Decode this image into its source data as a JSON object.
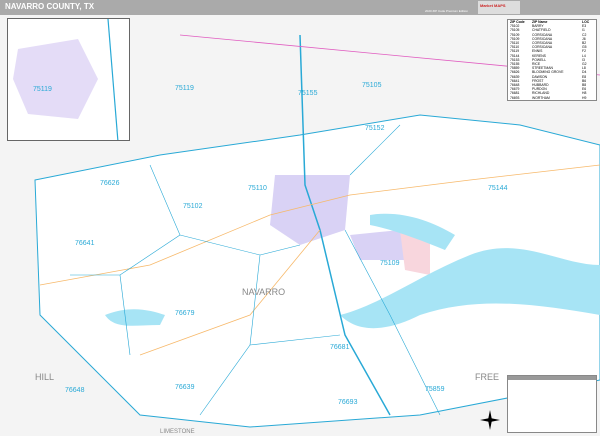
{
  "header": {
    "title": "NAVARRO COUNTY, TX",
    "edition": "2020 ZIP Code Premium Edition",
    "logo": "Market MAPS"
  },
  "zip_table": {
    "headers": [
      "ZIP Code",
      "ZIP Name",
      "LOC"
    ],
    "rows": [
      [
        "75102",
        "BARRY",
        "E3"
      ],
      [
        "75105",
        "CHATFIELD",
        "I1"
      ],
      [
        "75109",
        "CORSICANA",
        "C2"
      ],
      [
        "75109",
        "CORSICANA",
        "J6"
      ],
      [
        "75110",
        "CORSICANA",
        "B2"
      ],
      [
        "75110",
        "CORSICANA",
        "G5"
      ],
      [
        "75119",
        "ENNIS",
        "F2"
      ],
      [
        "75144",
        "KERENS",
        "L4"
      ],
      [
        "75153",
        "POWELL",
        "I3"
      ],
      [
        "75155",
        "RICE",
        "G2"
      ],
      [
        "75859",
        "STREETMAN",
        "L8"
      ],
      [
        "76626",
        "BLOOMING GROVE",
        "D4"
      ],
      [
        "76639",
        "DAWSON",
        "E8"
      ],
      [
        "76641",
        "FROST",
        "B6"
      ],
      [
        "76648",
        "HUBBARD",
        "B8"
      ],
      [
        "76679",
        "PURDON",
        "E6"
      ],
      [
        "76681",
        "RICHLAND",
        "H8"
      ],
      [
        "76693",
        "WORTHAM",
        "H9"
      ]
    ]
  },
  "map_labels": {
    "county": "NAVARRO",
    "neighbors": [
      "HILL",
      "FREE",
      "LIMESTONE"
    ],
    "zips": [
      "75119",
      "75155",
      "75105",
      "75152",
      "75110",
      "76626",
      "75102",
      "76641",
      "75144",
      "75109",
      "76679",
      "76681",
      "75859",
      "76648",
      "76639",
      "76693"
    ],
    "inset_zip": "75119"
  },
  "colors": {
    "zip_line": "#29a9d6",
    "water": "#a7e4f5",
    "header": "#aaaaaa"
  }
}
